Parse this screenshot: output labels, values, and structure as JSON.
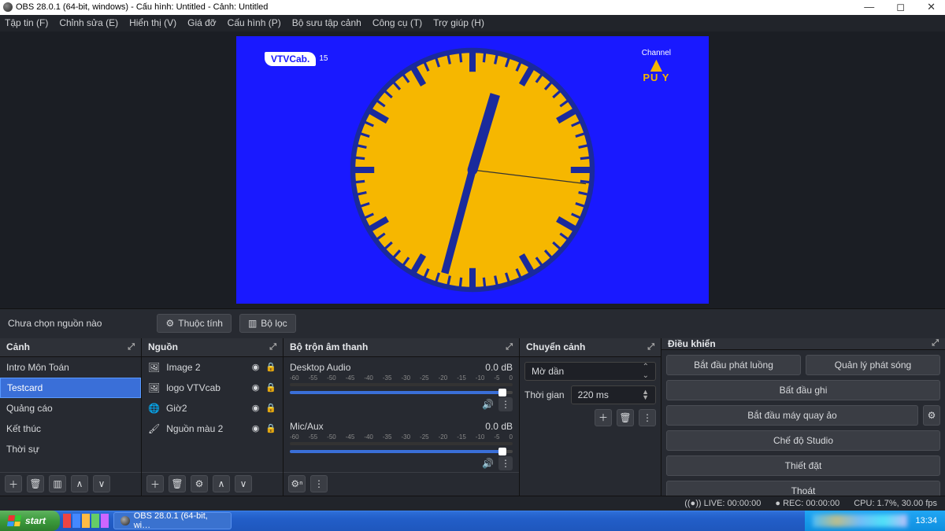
{
  "title": "OBS 28.0.1 (64-bit, windows) - Cấu hình: Untitled - Cảnh: Untitled",
  "menubar": [
    "Tập tin (F)",
    "Chỉnh sửa (E)",
    "Hiển thị (V)",
    "Giá đỡ",
    "Cấu hình (P)",
    "Bộ sưu tập cảnh",
    "Công cụ (T)",
    "Trợ giúp (H)"
  ],
  "preview": {
    "logo_left_text": "VTVCab.",
    "logo_left_num": "15",
    "logo_right_top": "Channel",
    "logo_right_v": "V",
    "logo_right_pu": "PU Y"
  },
  "toolbar": {
    "no_source": "Chưa chọn nguồn nào",
    "properties": "Thuộc tính",
    "filters": "Bộ lọc"
  },
  "panels": {
    "scenes": {
      "title": "Cảnh",
      "items": [
        "Intro Môn Toán",
        "Testcard",
        "Quảng cáo",
        "Kết thúc",
        "Thời sự"
      ],
      "selected": 1
    },
    "sources": {
      "title": "Nguồn",
      "items": [
        {
          "icon": "image",
          "label": "Image 2"
        },
        {
          "icon": "image",
          "label": "logo VTVcab"
        },
        {
          "icon": "globe",
          "label": "Giờ2"
        },
        {
          "icon": "brush",
          "label": "Nguồn màu 2"
        }
      ]
    },
    "mixer": {
      "title": "Bộ trộn âm thanh",
      "channels": [
        {
          "name": "Desktop Audio",
          "db": "0.0 dB"
        },
        {
          "name": "Mic/Aux",
          "db": "0.0 dB"
        }
      ],
      "scale": [
        "-60",
        "-55",
        "-50",
        "-45",
        "-40",
        "-35",
        "-30",
        "-25",
        "-20",
        "-15",
        "-10",
        "-5",
        "0"
      ]
    },
    "transitions": {
      "title": "Chuyển cảnh",
      "selected": "Mờ dần",
      "duration_label": "Thời gian",
      "duration_value": "220 ms"
    },
    "controls": {
      "title": "Điều khiển",
      "buttons": {
        "start_stream": "Bắt đầu phát luồng",
        "manage_broadcast": "Quản lý phát sóng",
        "start_record": "Bất đầu ghi",
        "start_vcam": "Bắt đầu máy quay ảo",
        "studio": "Chế độ Studio",
        "settings": "Thiết đặt",
        "exit": "Thoát"
      }
    }
  },
  "statusbar": {
    "live": "LIVE: 00:00:00",
    "rec": "REC: 00:00:00",
    "cpu": "CPU: 1.7%, 30.00 fps"
  },
  "taskbar": {
    "start": "start",
    "task": "OBS 28.0.1 (64-bit, wi…",
    "clock": "13:34"
  }
}
